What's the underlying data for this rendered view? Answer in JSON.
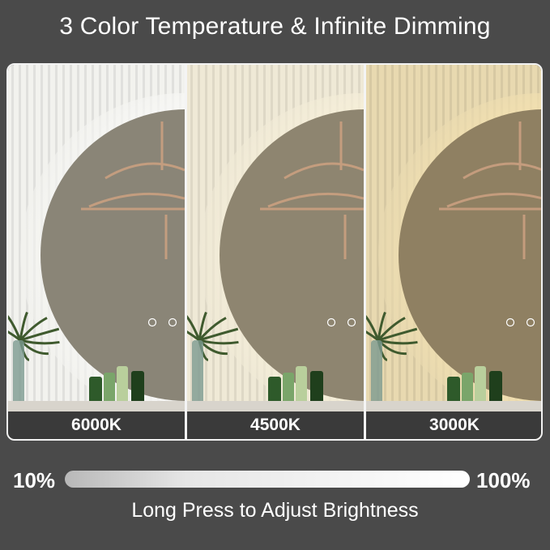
{
  "title": "3 Color Temperature & Infinite Dimming",
  "panels": [
    {
      "label": "6000K",
      "wall": "#f2f2ee",
      "glow": "#ffffff",
      "mirror": "#8a8577"
    },
    {
      "label": "4500K",
      "wall": "#efe9d6",
      "glow": "#fff6dc",
      "mirror": "#8e8570"
    },
    {
      "label": "3000K",
      "wall": "#e8d9b0",
      "glow": "#ffe9b0",
      "mirror": "#8f8062"
    }
  ],
  "brightness": {
    "min_label": "10%",
    "max_label": "100%",
    "caption": "Long Press to Adjust Brightness"
  }
}
